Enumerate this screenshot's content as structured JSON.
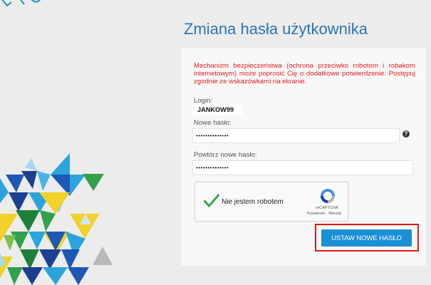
{
  "page": {
    "title": "Zmiana hasła użytkownika",
    "notice": "Mechanizm bezpieczeństwa (ochrona przeciwko robotom i robakom internetowym) może poprosić Cię o dodatkowe potwierdzenie. Postępuj zgodnie ze wskazówkami na ekranie."
  },
  "form": {
    "login_label": "Login:",
    "login_value": "JANKOW99",
    "new_password_label": "Nowe hasło:",
    "new_password_value": "••••••••••••••",
    "repeat_password_label": "Powtórz nowe hasło:",
    "repeat_password_value": "••••••••••••••",
    "help_icon": "?",
    "submit_label": "USTAW NOWE HASŁO"
  },
  "recaptcha": {
    "label": "Nie jestem robotem",
    "checked": true,
    "brand": "reCAPTCHA",
    "privacy_link": "Prywatność",
    "separator": " - ",
    "terms_link": "Warunki"
  },
  "icons": {
    "help": "question-circle-icon",
    "check": "checkmark-icon",
    "recaptcha_logo": "recaptcha-logo-icon"
  },
  "colors": {
    "title": "#2a76b4",
    "notice": "#e01e1e",
    "button": "#1b8fd6",
    "highlight": "#e01818",
    "check": "#33a852",
    "background": "#ececec",
    "panel": "#f8f8f8"
  }
}
